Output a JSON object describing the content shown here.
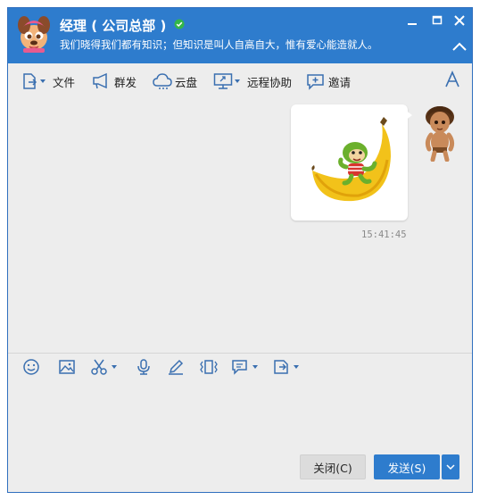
{
  "header": {
    "contact_name": "经理 ( 公司总部 )",
    "signature": "我们晓得我们都有知识；但知识是叫人自高自大，惟有爱心能造就人。"
  },
  "toolbar": {
    "file": "文件",
    "group_send": "群发",
    "cloud_disk": "云盘",
    "remote_assist": "远程协助",
    "invite": "邀请",
    "font_glyph": "A"
  },
  "chat": {
    "messages": [
      {
        "sender": "me",
        "type": "sticker",
        "sticker": "banana-monkey",
        "time": "15:41:45"
      }
    ]
  },
  "footer": {
    "close_label": "关闭(C)",
    "send_label": "发送(S)"
  },
  "colors": {
    "accent": "#2e7ccd",
    "background": "#ededed",
    "online": "#33b64a"
  }
}
